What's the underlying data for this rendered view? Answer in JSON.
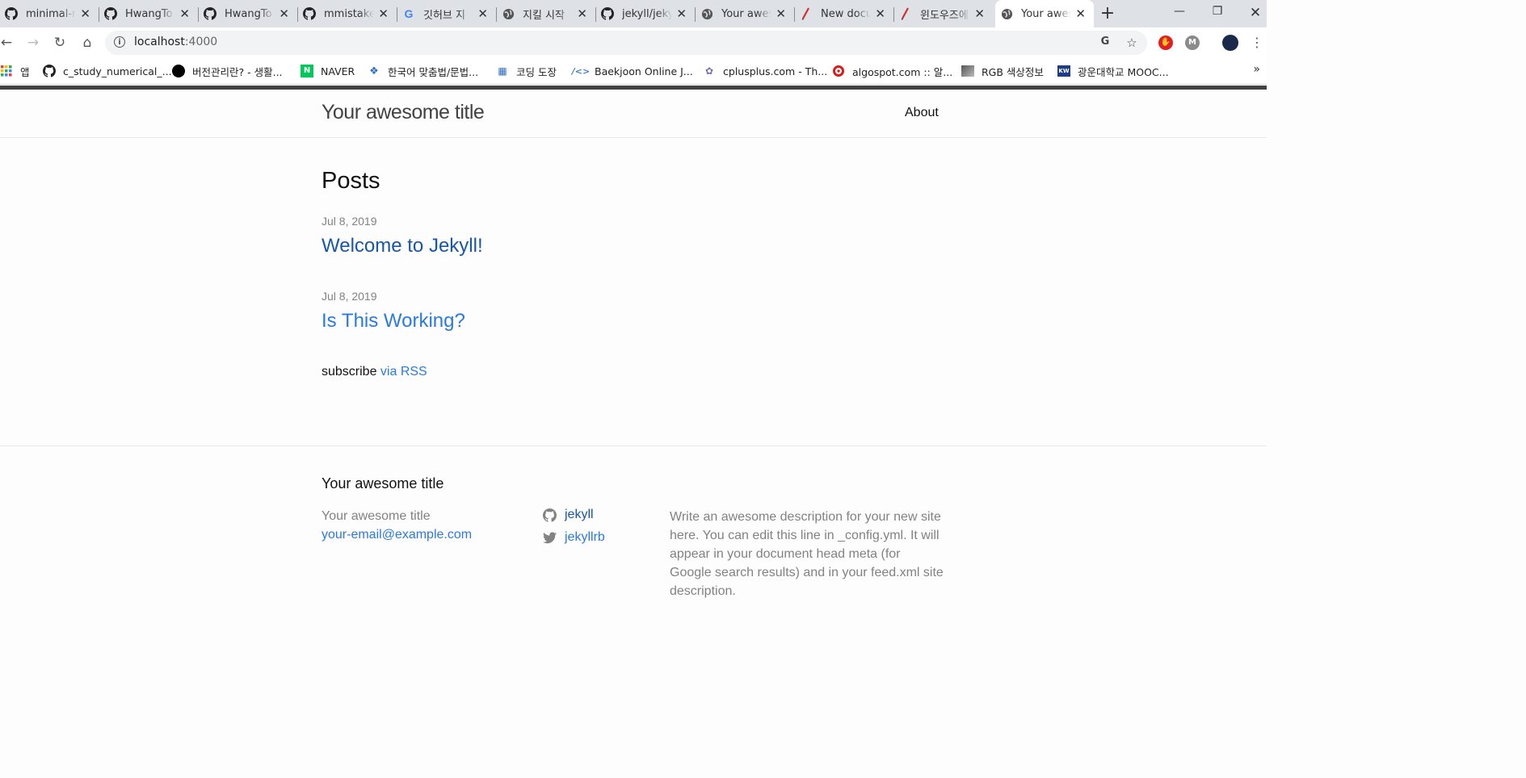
{
  "browser": {
    "tabs": [
      {
        "title": "minimal-mistakes",
        "icon": "github-icon"
      },
      {
        "title": "HwangTo",
        "icon": "github-icon"
      },
      {
        "title": "HwangTo",
        "icon": "github-icon"
      },
      {
        "title": "mmistakes",
        "icon": "github-icon"
      },
      {
        "title": "깃허브 지",
        "icon": "google-icon"
      },
      {
        "title": "지킬 시작",
        "icon": "globe-icon"
      },
      {
        "title": "jekyll/jekyll",
        "icon": "github-icon"
      },
      {
        "title": "Your awesome",
        "icon": "globe-icon"
      },
      {
        "title": "New document",
        "icon": "pen-icon"
      },
      {
        "title": "윈도우즈에",
        "icon": "pen-icon"
      },
      {
        "title": "Your awesome",
        "icon": "globe-icon",
        "active": true
      }
    ],
    "url_host": "localhost",
    "url_port": ":4000",
    "bookmarks": [
      {
        "label": "앱",
        "icon": "apps-icon"
      },
      {
        "label": "c_study_numerical_...",
        "icon": "github-icon"
      },
      {
        "label": "버전관리란? - 생활...",
        "icon": "circle-icon"
      },
      {
        "label": "NAVER",
        "icon": "naver-icon"
      },
      {
        "label": "한국어 맞춤법/문법...",
        "icon": "spell-icon"
      },
      {
        "label": "코딩 도장",
        "icon": "dojang-icon"
      },
      {
        "label": "Baekjoon Online J...",
        "icon": "code-icon"
      },
      {
        "label": "cplusplus.com - Th...",
        "icon": "cplusplus-icon"
      },
      {
        "label": "algospot.com :: 알...",
        "icon": "target-icon"
      },
      {
        "label": "RGB 색상정보",
        "icon": "rgb-icon"
      },
      {
        "label": "광운대학교 MOOC...",
        "icon": "kw-icon"
      }
    ],
    "more_label": "»"
  },
  "site": {
    "title": "Your awesome title",
    "nav_about": "About"
  },
  "main": {
    "heading": "Posts",
    "posts": [
      {
        "date": "Jul 8, 2019",
        "title": "Welcome to Jekyll!",
        "visited": true
      },
      {
        "date": "Jul 8, 2019",
        "title": "Is This Working?",
        "visited": false
      }
    ],
    "subscribe_text": "subscribe ",
    "subscribe_link": "via RSS"
  },
  "footer": {
    "heading": "Your awesome title",
    "name": "Your awesome title",
    "email": "your-email@example.com",
    "github": "jekyll",
    "twitter": "jekyllrb",
    "description": "Write an awesome description for your new site here. You can edit this line in _config.yml. It will appear in your document head meta (for Google search results) and in your feed.xml site description."
  },
  "colors": {
    "link": "#2a7ae2",
    "visited": "#1756a9",
    "meta": "#828282",
    "chrome_bg": "#dee1e6"
  }
}
